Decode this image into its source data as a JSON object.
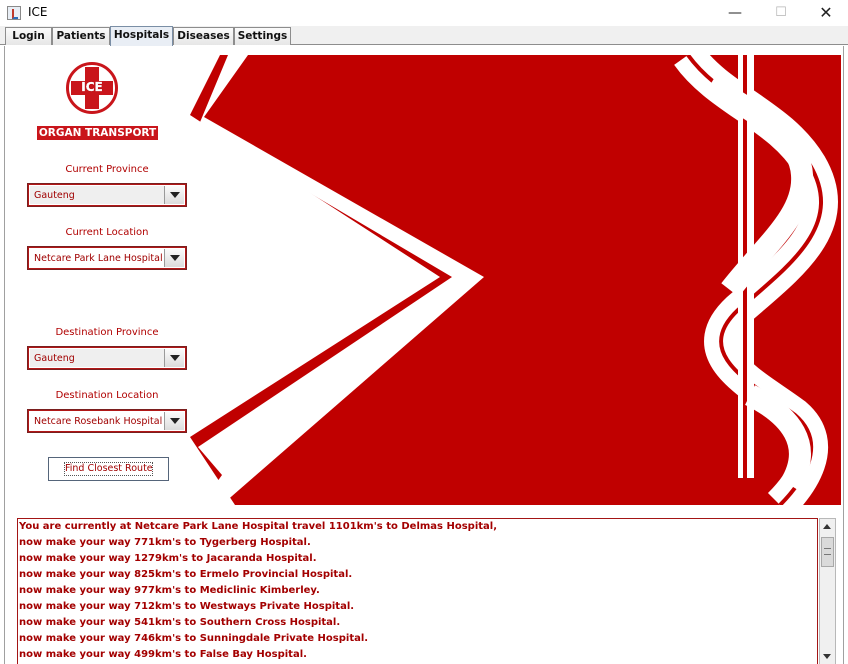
{
  "window": {
    "title": "ICE",
    "icon": "java-cup-icon",
    "controls": {
      "minimize": "—",
      "maximize": "☐",
      "close": "✕"
    }
  },
  "tabs": [
    {
      "label": "Login",
      "active": false
    },
    {
      "label": "Patients",
      "active": false
    },
    {
      "label": "Hospitals",
      "active": true
    },
    {
      "label": "Diseases",
      "active": false
    },
    {
      "label": "Settings",
      "active": false
    }
  ],
  "logo": {
    "badge_text": "ICE",
    "banner_text": "ORGAN TRANSPORT",
    "color": "#c9151b"
  },
  "form": {
    "current_province": {
      "label": "Current Province",
      "value": "Gauteng"
    },
    "current_location": {
      "label": "Current Location",
      "value": "Netcare Park Lane Hospital"
    },
    "destination_province": {
      "label": "Destination Province",
      "value": "Gauteng"
    },
    "destination_location": {
      "label": "Destination Location",
      "value": "Netcare Rosebank Hospital"
    },
    "find_button_label": "Find Closest Route"
  },
  "hero": {
    "description_icon": "rod-of-asclepius-icon",
    "accent": "#c00000"
  },
  "output": {
    "lines": [
      " You are currently at Netcare Park Lane Hospital travel 1101km's to Delmas Hospital,",
      "now make your way 771km's to Tygerberg Hospital.",
      "now make your way 1279km's to Jacaranda Hospital.",
      "now make your way 825km's to Ermelo Provincial Hospital.",
      "now make your way 977km's to Mediclinic Kimberley.",
      "now make your way 712km's to Westways Private Hospital.",
      "now make your way 541km's to Southern Cross Hospital.",
      "now make your way 746km's to Sunningdale Private Hospital.",
      "now make your way 499km's to False Bay Hospital."
    ],
    "text_color": "#a30000"
  }
}
